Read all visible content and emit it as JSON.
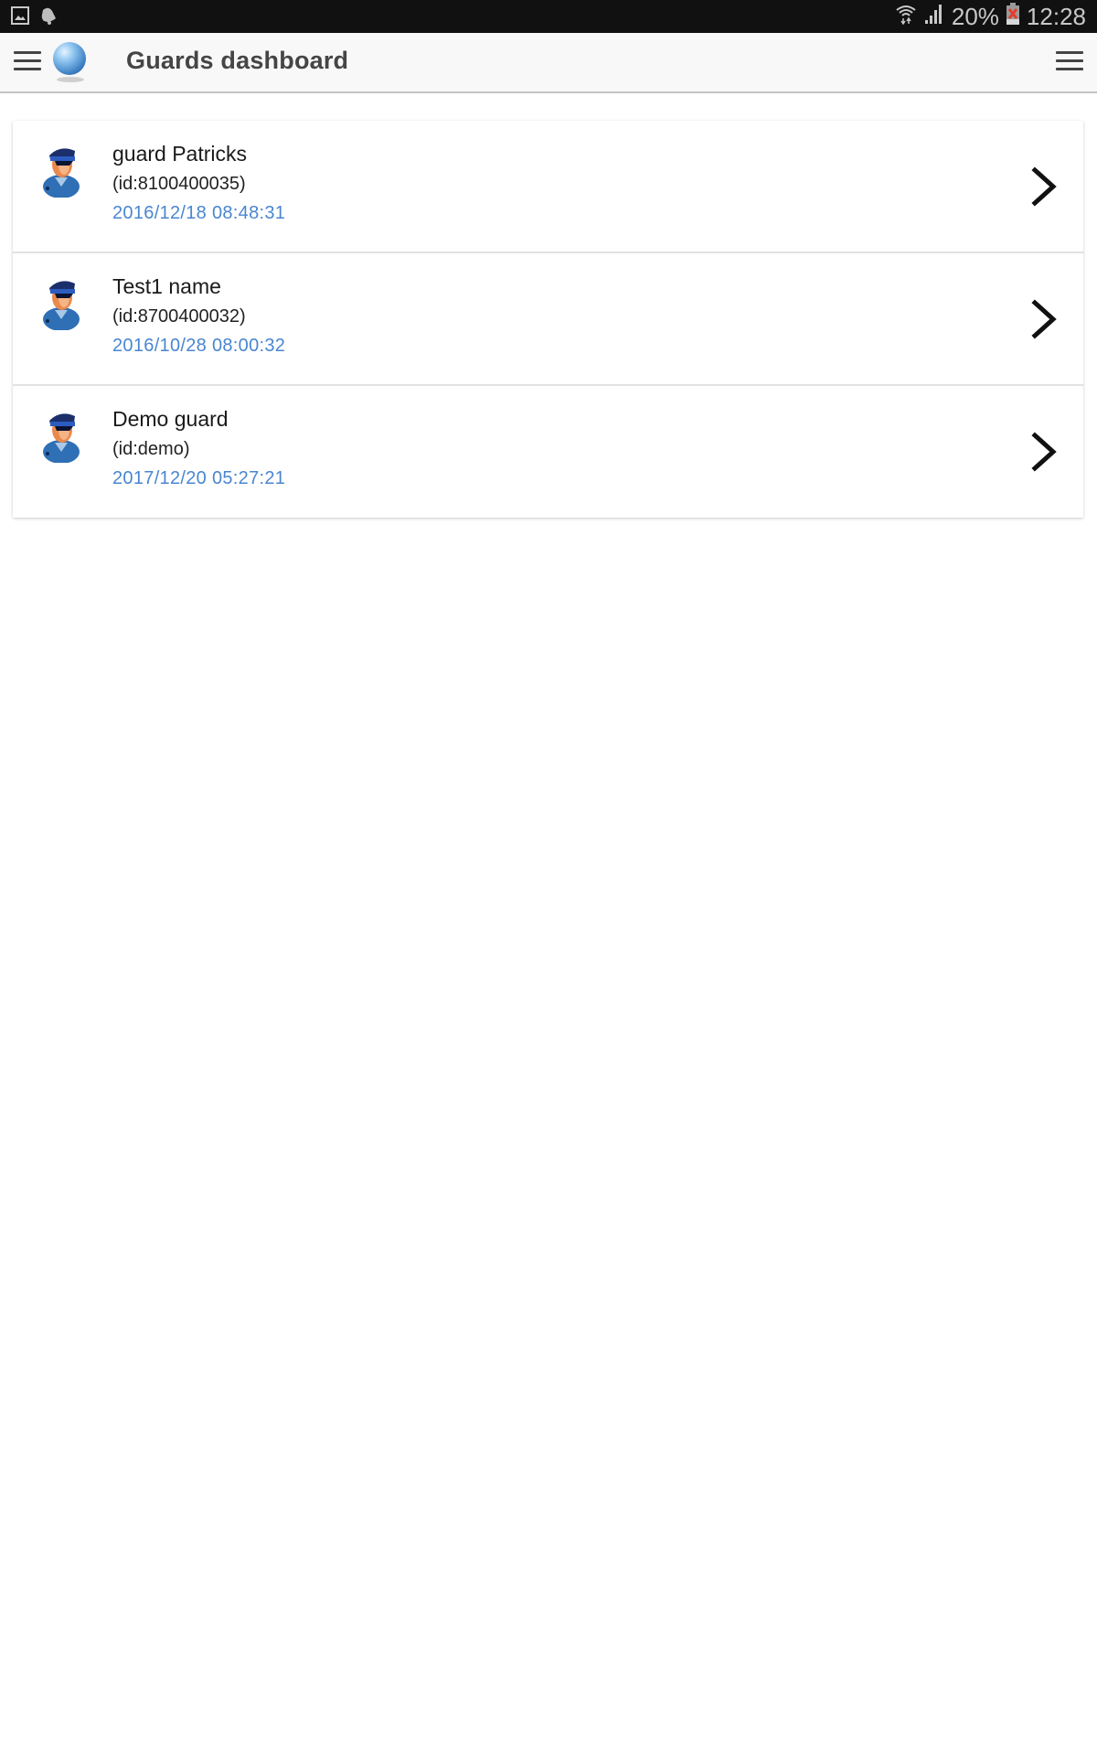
{
  "statusbar": {
    "left_icons": [
      "image-icon",
      "notification-bell-icon"
    ],
    "battery_percent": "20%",
    "time": "12:28"
  },
  "appbar": {
    "title": "Guards dashboard"
  },
  "colors": {
    "accent": "#4a86d0",
    "appbar_bg": "#f8f8f8",
    "statusbar_bg": "#111111"
  },
  "guards": [
    {
      "name": "guard Patricks",
      "id": "(id:8100400035)",
      "last_seen": "2016/12/18 08:48:31"
    },
    {
      "name": "Test1 name",
      "id": "(id:8700400032)",
      "last_seen": "2016/10/28 08:00:32"
    },
    {
      "name": "Demo guard",
      "id": "(id:demo)",
      "last_seen": "2017/12/20 05:27:21"
    }
  ]
}
